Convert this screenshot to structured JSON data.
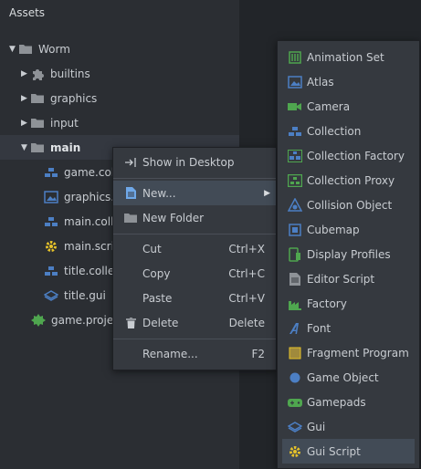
{
  "panel": {
    "title": "Assets"
  },
  "tree": [
    {
      "label": "Worm",
      "icon": "folder-icon"
    },
    {
      "label": "builtins",
      "icon": "puzzle-icon"
    },
    {
      "label": "graphics",
      "icon": "folder-icon"
    },
    {
      "label": "input",
      "icon": "folder-icon"
    },
    {
      "label": "main",
      "icon": "folder-icon"
    },
    {
      "label": "game.colle",
      "icon": "collection-icon"
    },
    {
      "label": "graphics.a",
      "icon": "atlas-icon"
    },
    {
      "label": "main.colle",
      "icon": "collection-icon"
    },
    {
      "label": "main.scrip",
      "icon": "script-icon"
    },
    {
      "label": "title.collec",
      "icon": "collection-icon"
    },
    {
      "label": "title.gui",
      "icon": "gui-icon"
    },
    {
      "label": "game.projec",
      "icon": "project-icon"
    }
  ],
  "context_menu": {
    "show_in_desktop": "Show in Desktop",
    "new": "New...",
    "new_folder": "New Folder",
    "cut": {
      "label": "Cut",
      "shortcut": "Ctrl+X"
    },
    "copy": {
      "label": "Copy",
      "shortcut": "Ctrl+C"
    },
    "paste": {
      "label": "Paste",
      "shortcut": "Ctrl+V"
    },
    "delete": {
      "label": "Delete",
      "shortcut": "Delete"
    },
    "rename": {
      "label": "Rename...",
      "shortcut": "F2"
    }
  },
  "submenu": [
    {
      "label": "Animation Set",
      "icon": "animation-set-icon"
    },
    {
      "label": "Atlas",
      "icon": "atlas-icon"
    },
    {
      "label": "Camera",
      "icon": "camera-icon"
    },
    {
      "label": "Collection",
      "icon": "collection-icon"
    },
    {
      "label": "Collection Factory",
      "icon": "collection-factory-icon"
    },
    {
      "label": "Collection Proxy",
      "icon": "collection-proxy-icon"
    },
    {
      "label": "Collision Object",
      "icon": "collision-object-icon"
    },
    {
      "label": "Cubemap",
      "icon": "cubemap-icon"
    },
    {
      "label": "Display Profiles",
      "icon": "display-profiles-icon"
    },
    {
      "label": "Editor Script",
      "icon": "editor-script-icon"
    },
    {
      "label": "Factory",
      "icon": "factory-icon"
    },
    {
      "label": "Font",
      "icon": "font-icon"
    },
    {
      "label": "Fragment Program",
      "icon": "fragment-program-icon"
    },
    {
      "label": "Game Object",
      "icon": "game-object-icon"
    },
    {
      "label": "Gamepads",
      "icon": "gamepads-icon"
    },
    {
      "label": "Gui",
      "icon": "gui-icon"
    },
    {
      "label": "Gui Script",
      "icon": "gui-script-icon"
    }
  ],
  "colors": {
    "green": "#4fa64f",
    "blue": "#4c7fc4",
    "folder": "#8e9297",
    "yellow": "#e6c229"
  }
}
